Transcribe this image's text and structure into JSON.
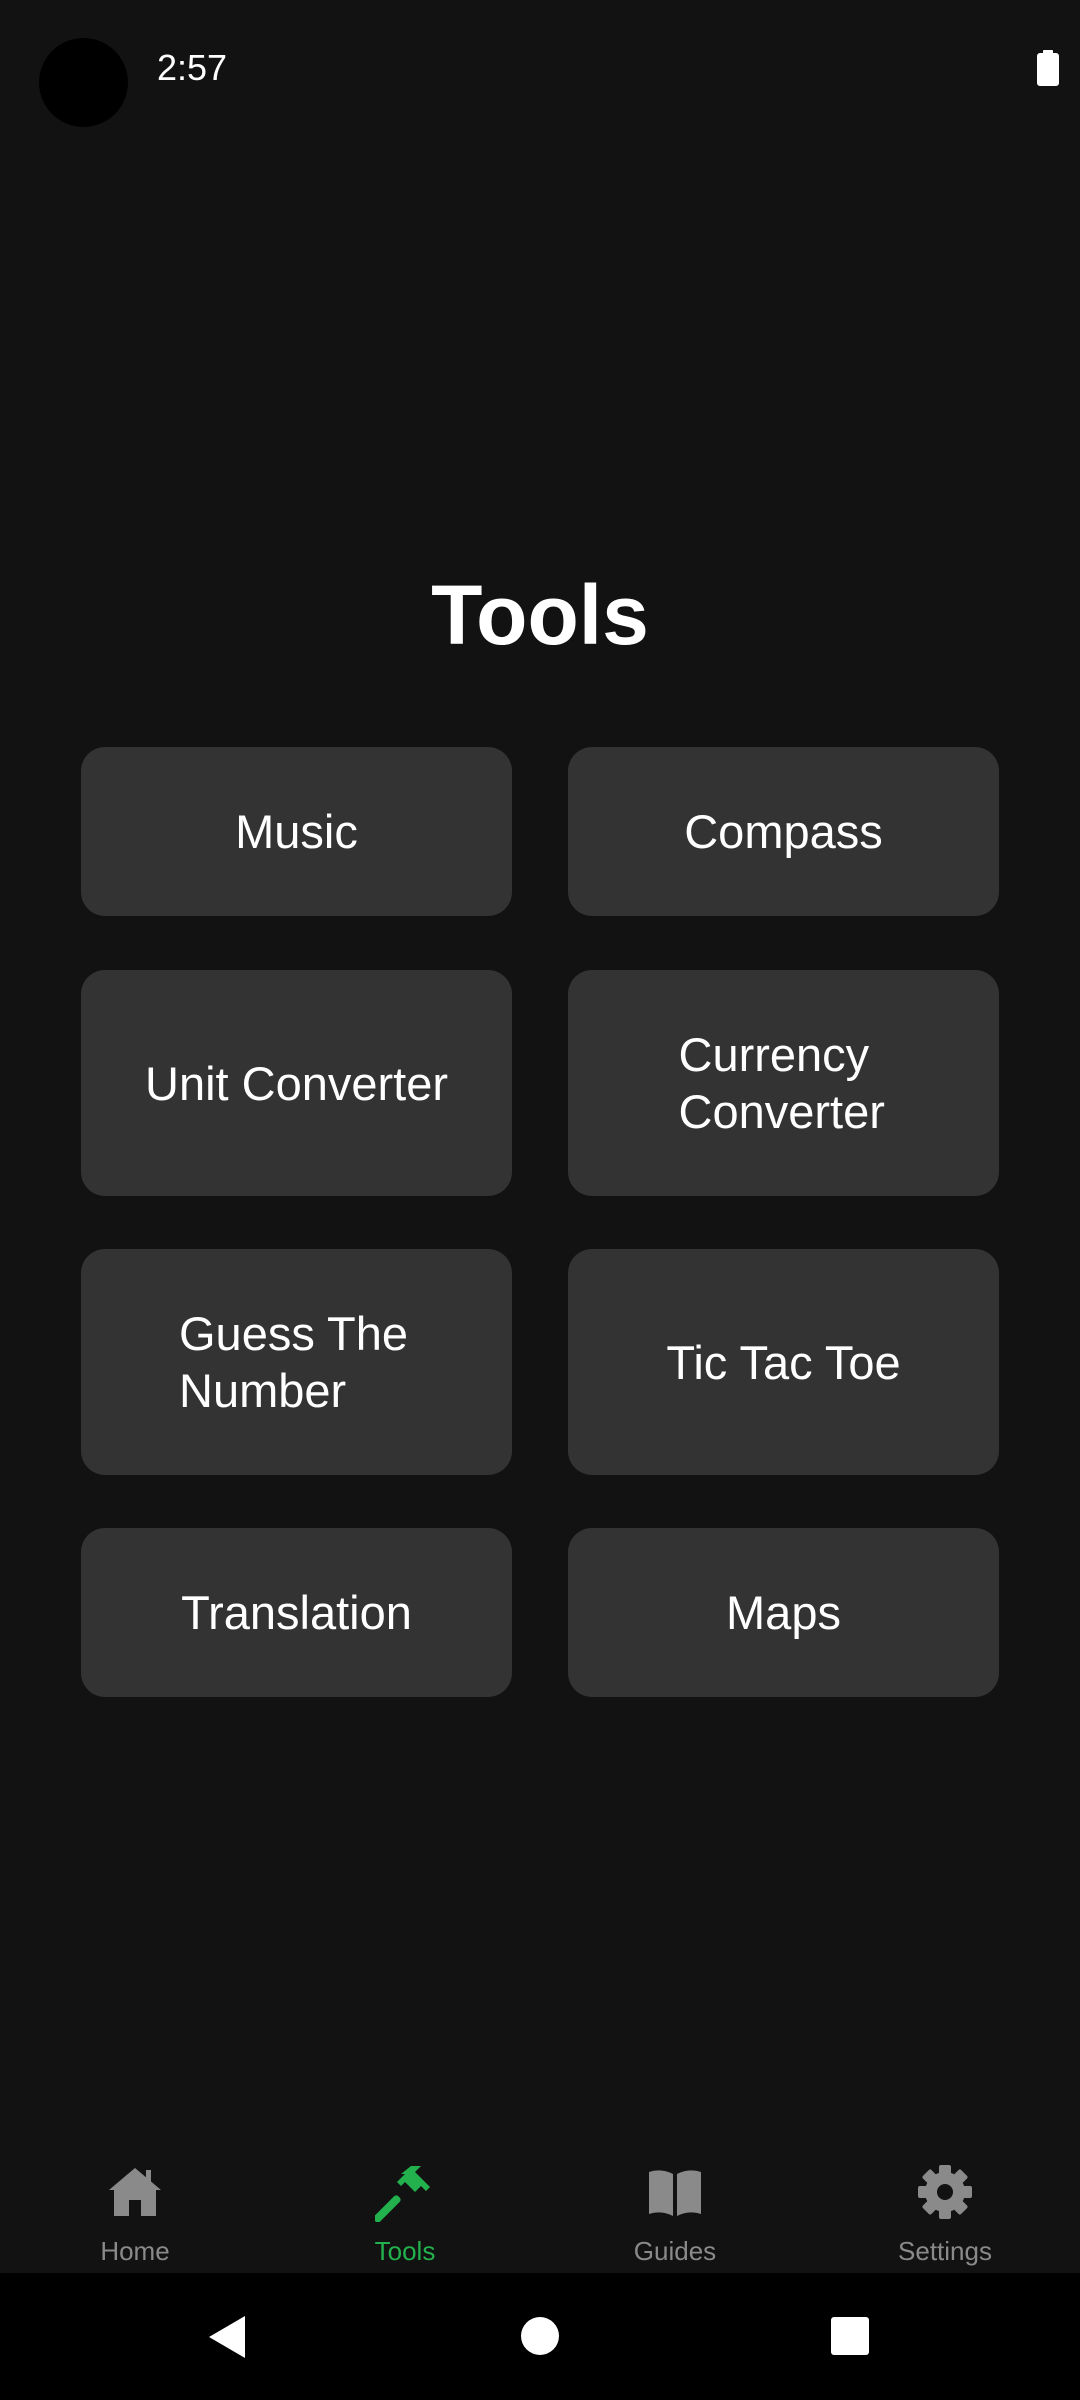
{
  "status_bar": {
    "time": "2:57"
  },
  "title": "Tools",
  "tools": [
    {
      "label": "Music"
    },
    {
      "label": "Compass"
    },
    {
      "label": "Unit Converter"
    },
    {
      "label": "Currency Converter"
    },
    {
      "label": "Guess The Number"
    },
    {
      "label": "Tic Tac Toe"
    },
    {
      "label": "Translation"
    },
    {
      "label": "Maps"
    }
  ],
  "bottom_nav": {
    "items": [
      {
        "label": "Home",
        "icon": "home-icon",
        "active": false
      },
      {
        "label": "Tools",
        "icon": "hammer-icon",
        "active": true
      },
      {
        "label": "Guides",
        "icon": "book-icon",
        "active": false
      },
      {
        "label": "Settings",
        "icon": "gear-icon",
        "active": false
      }
    ]
  },
  "colors": {
    "background": "#121212",
    "button": "#333333",
    "accent": "#22b14c",
    "inactive": "#8a8a8a"
  }
}
